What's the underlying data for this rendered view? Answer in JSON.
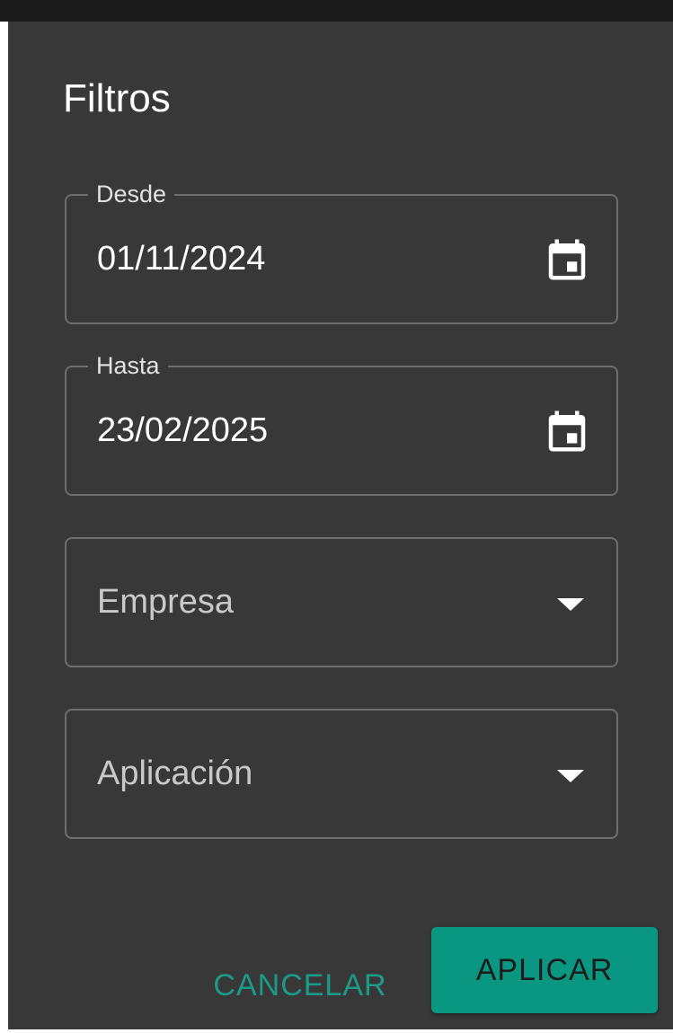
{
  "dialog": {
    "title": "Filtros"
  },
  "fields": {
    "desde": {
      "label": "Desde",
      "value": "01/11/2024",
      "icon": "calendar-icon"
    },
    "hasta": {
      "label": "Hasta",
      "value": "23/02/2025",
      "icon": "calendar-icon"
    },
    "empresa": {
      "placeholder": "Empresa",
      "icon": "dropdown-arrow-icon"
    },
    "aplicacion": {
      "placeholder": "Aplicación",
      "icon": "dropdown-arrow-icon"
    }
  },
  "actions": {
    "cancel_label": "CANCELAR",
    "apply_label": "APLICAR"
  },
  "colors": {
    "dialog_background": "#383838",
    "accent": "#0a9781",
    "accent_text": "#1b9b87",
    "border": "#6e6e6e"
  }
}
